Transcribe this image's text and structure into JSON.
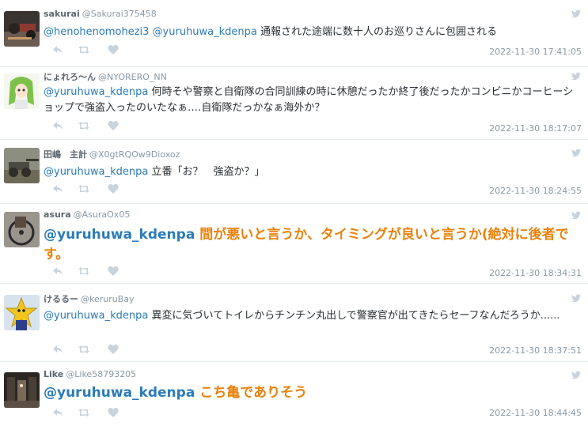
{
  "colors": {
    "mention": "#2b7bb9",
    "highlight": "#e8820c",
    "muted": "#8899a6"
  },
  "tweets": [
    {
      "name": "sakurai",
      "handle": "@Sakurai375458",
      "mentions": "@henohenomohezi3 @yuruhuwa_kdenpa",
      "text": "通報された途端に数十人のお巡りさんに包囲される",
      "time": "2022-11-30 17:41:05"
    },
    {
      "name": "にょれろ〜ん",
      "handle": "@NYORERO_NN",
      "mentions": "@yuruhuwa_kdenpa",
      "text": "何時そや警察と自衛隊の合同訓練の時に休憩だったか終了後だったかコンビニかコーヒーショップで強盗入ったのいたなぁ‥‥自衛隊だっかなぁ海外か？",
      "time": "2022-11-30 18:17:07"
    },
    {
      "name": "田嶋　主計",
      "handle": "@X0gtRQOw9Dioxoz",
      "mentions": "@yuruhuwa_kdenpa",
      "text": "立番「お？　強盗か？」",
      "time": "2022-11-30 18:24:55"
    },
    {
      "name": "asura",
      "handle": "@AsuraOx05",
      "mentions": "@yuruhuwa_kdenpa",
      "text": "間が悪いと言うか、タイミングが良いと言うか(絶対に後者です。",
      "time": "2022-11-30 18:34:31"
    },
    {
      "name": "けるるー",
      "handle": "@keruruBay",
      "mentions": "@yuruhuwa_kdenpa",
      "text": "異変に気づいてトイレからチンチン丸出しで警察官が出てきたらセーフなんだろうか......",
      "time": "2022-11-30 18:37:51"
    },
    {
      "name": "Like",
      "handle": "@Like58793205",
      "mentions": "@yuruhuwa_kdenpa",
      "text": "こち亀でありそう",
      "time": "2022-11-30 18:44:45"
    }
  ]
}
